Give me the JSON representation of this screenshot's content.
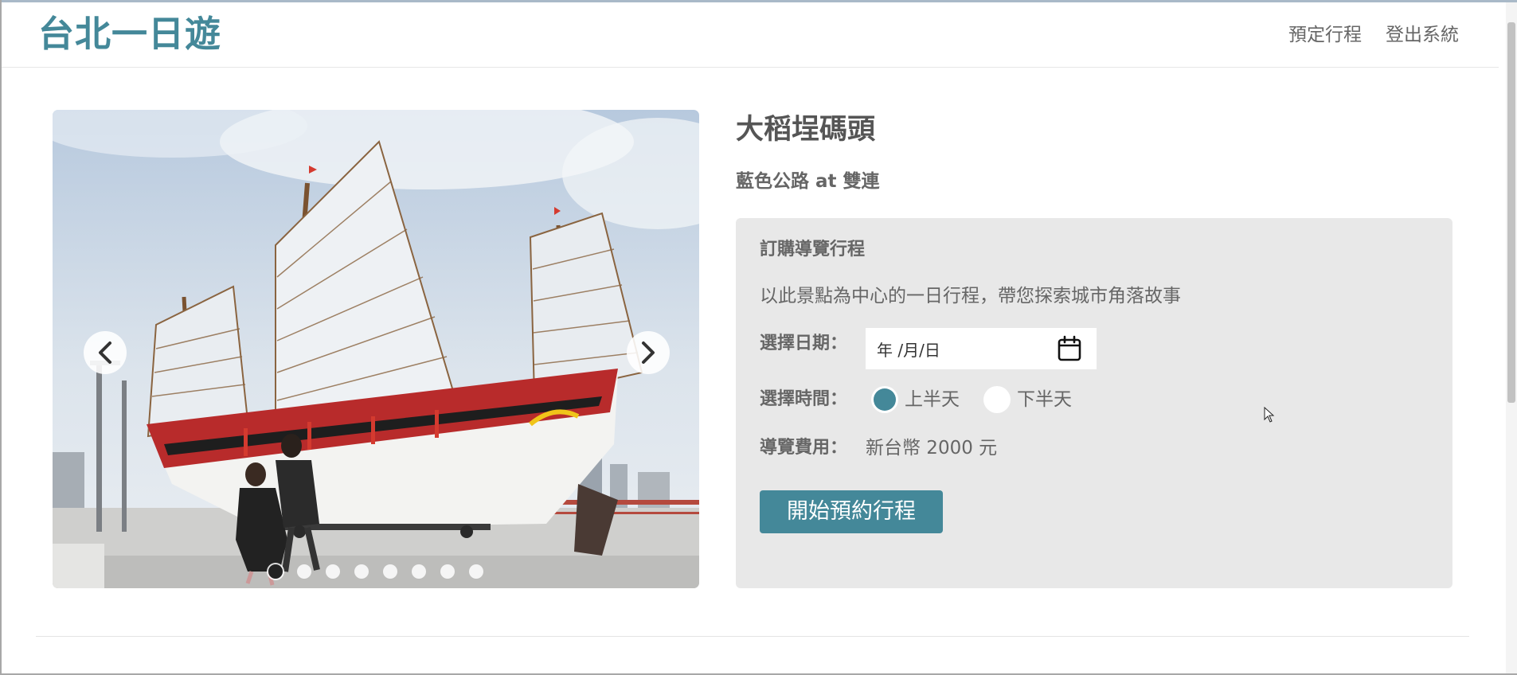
{
  "navbar": {
    "brand": "台北一日遊",
    "links": [
      "預定行程",
      "登出系統"
    ]
  },
  "carousel": {
    "icons": {
      "prev": "chevron-left-icon",
      "next": "chevron-right-icon"
    },
    "slide_count": 8,
    "active_index": 0
  },
  "attraction": {
    "title": "大稻埕碼頭",
    "subtitle": "藍色公路 at 雙連"
  },
  "booking": {
    "heading": "訂購導覽行程",
    "description": "以此景點為中心的一日行程，帶您探索城市角落故事",
    "date_label": "選擇日期：",
    "date_placeholder": "年 /月/日",
    "time_label": "選擇時間：",
    "time_options": [
      "上半天",
      "下半天"
    ],
    "selected_time": "上半天",
    "fee_label": "導覽費用：",
    "fee_value": "新台幣 2000 元",
    "submit_label": "開始預約行程"
  },
  "colors": {
    "accent": "#448899",
    "panel": "#e8e8e8",
    "text": "#666666"
  }
}
